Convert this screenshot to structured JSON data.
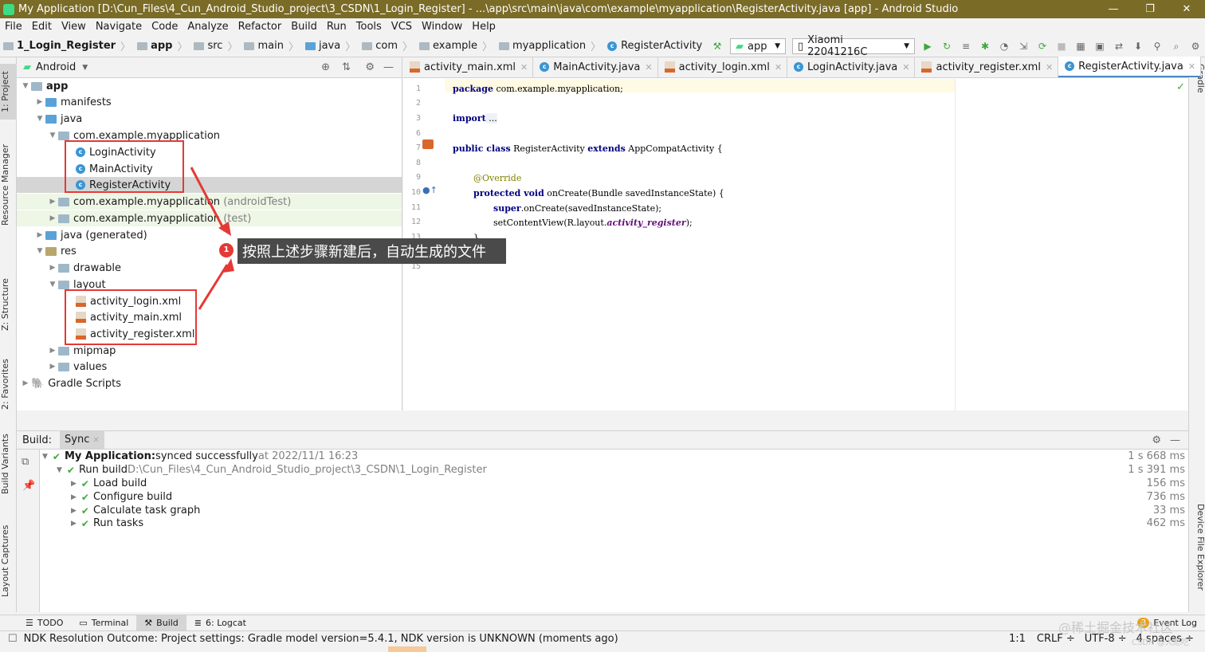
{
  "titlebar": {
    "title": "My Application [D:\\Cun_Files\\4_Cun_Android_Studio_project\\3_CSDN\\1_Login_Register] - ...\\app\\src\\main\\java\\com\\example\\myapplication\\RegisterActivity.java [app] - Android Studio",
    "min": "—",
    "max": "❐",
    "close": "✕"
  },
  "menu": [
    "File",
    "Edit",
    "View",
    "Navigate",
    "Code",
    "Analyze",
    "Refactor",
    "Build",
    "Run",
    "Tools",
    "VCS",
    "Window",
    "Help"
  ],
  "breadcrumbs": [
    "1_Login_Register",
    "app",
    "src",
    "main",
    "java",
    "com",
    "example",
    "myapplication",
    "RegisterActivity"
  ],
  "toolbar": {
    "config": "app",
    "device": "Xiaomi 22041216C"
  },
  "side_tabs": {
    "project": "1: Project",
    "resource": "Resource Manager",
    "structure": "Z: Structure",
    "favorites": "2: Favorites",
    "variants": "Build Variants",
    "captures": "Layout Captures",
    "gradle": "Gradle",
    "device_explorer": "Device File Explorer"
  },
  "project": {
    "view": "Android",
    "tree": [
      "app",
      "manifests",
      "java",
      "com.example.myapplication",
      "LoginActivity",
      "MainActivity",
      "RegisterActivity",
      "com.example.myapplication",
      "(androidTest)",
      "com.example.myapplication",
      "(test)",
      "java (generated)",
      "res",
      "drawable",
      "layout",
      "activity_login.xml",
      "activity_main.xml",
      "activity_register.xml",
      "mipmap",
      "values",
      "Gradle Scripts"
    ]
  },
  "tabs": [
    "activity_main.xml",
    "MainActivity.java",
    "activity_login.xml",
    "LoginActivity.java",
    "activity_register.xml",
    "RegisterActivity.java"
  ],
  "code": {
    "line_numbers": [
      "1",
      "2",
      "3",
      "6",
      "7",
      "8",
      "9",
      "10",
      "11",
      "12",
      "13",
      "14",
      "15"
    ],
    "l1_kw": "package",
    "l1_rest": " com.example.myapplication;",
    "l3_kw": "import",
    "l3_rest": " ...",
    "l7_kw": "public class",
    "l7_mid": " RegisterActivity ",
    "l7_kw2": "extends",
    "l7_rest": " AppCompatActivity {",
    "l9": "@Override",
    "l10_kw": "protected void",
    "l10_rest": " onCreate(Bundle savedInstanceState) {",
    "l11_kw": "super",
    "l11_rest": ".onCreate(savedInstanceState);",
    "l12_pre": "setContentView(R.layout.",
    "l12_it": "activity_register",
    "l12_post": ");",
    "l13": "}"
  },
  "callout": {
    "number": "1",
    "text": "按照上述步骤新建后，自动生成的文件"
  },
  "build": {
    "tab_build": "Build:",
    "tab_sync": "Sync",
    "rows": [
      {
        "bold": "My Application:",
        "text": " synced successfully",
        "meta": " at 2022/11/1 16:23",
        "time": "1 s 668 ms"
      },
      {
        "text": "Run build",
        "meta": " D:\\Cun_Files\\4_Cun_Android_Studio_project\\3_CSDN\\1_Login_Register",
        "time": "1 s 391 ms"
      },
      {
        "text": "Load build",
        "time": "156 ms"
      },
      {
        "text": "Configure build",
        "time": "736 ms"
      },
      {
        "text": "Calculate task graph",
        "time": "33 ms"
      },
      {
        "text": "Run tasks",
        "time": "462 ms"
      }
    ]
  },
  "bottom_tabs": [
    "TODO",
    "Terminal",
    "Build",
    "6: Logcat"
  ],
  "event_log": {
    "count": "3",
    "label": "Event Log"
  },
  "status": {
    "message": "NDK Resolution Outcome: Project settings: Gradle model version=5.4.1, NDK version is UNKNOWN (moments ago)",
    "position": "1:1",
    "line_sep": "CRLF ÷",
    "encoding": "UTF-8 ÷",
    "indent": "4 spaces ÷"
  },
  "watermark": {
    "main": "@稀土掘金技术社区",
    "sub": "CSDN @大彪吃"
  },
  "colors": {
    "title_bg": "#7a6b27",
    "highlight_red": "#e53935",
    "check_green": "#3ea83e"
  }
}
